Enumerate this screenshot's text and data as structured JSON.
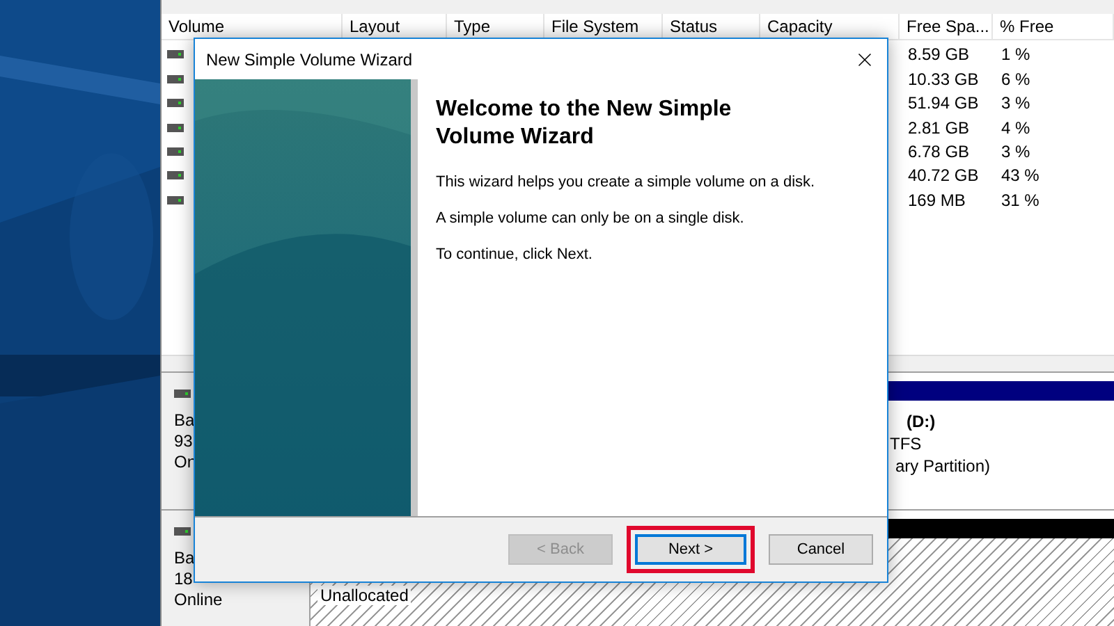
{
  "disk_management": {
    "columns": [
      "Volume",
      "Layout",
      "Type",
      "File System",
      "Status",
      "Capacity",
      "Free Spa...",
      "% Free"
    ],
    "rows": [
      {
        "free_space": "8.59 GB",
        "percent_free": "1 %"
      },
      {
        "free_space": "10.33 GB",
        "percent_free": "6 %"
      },
      {
        "free_space": "51.94 GB",
        "percent_free": "3 %"
      },
      {
        "free_space": "2.81 GB",
        "percent_free": "4 %"
      },
      {
        "free_space": "6.78 GB",
        "percent_free": "3 %"
      },
      {
        "free_space": "40.72 GB",
        "percent_free": "43 %"
      },
      {
        "free_space": "169 MB",
        "percent_free": "31 %"
      }
    ],
    "disks": [
      {
        "kind": "primary",
        "lines": [
          "Ba",
          "93",
          "On"
        ],
        "partition": {
          "name": "(D:)",
          "file_system": "TFS",
          "type": "ary Partition)"
        }
      },
      {
        "kind": "unallocated",
        "lines": [
          "Ba",
          "18",
          "Online"
        ],
        "partition": {
          "name": "Unallocated"
        }
      }
    ]
  },
  "wizard": {
    "title": "New Simple Volume Wizard",
    "heading": "Welcome to the New Simple Volume Wizard",
    "paragraphs": [
      "This wizard helps you create a simple volume on a disk.",
      "A simple volume can only be on a single disk.",
      "To continue, click Next."
    ],
    "buttons": [
      {
        "label": "< Back",
        "disabled": true,
        "default": false,
        "highlighted": false
      },
      {
        "label": "Next >",
        "disabled": false,
        "default": true,
        "highlighted": true
      },
      {
        "label": "Cancel",
        "disabled": false,
        "default": false,
        "highlighted": false
      }
    ]
  }
}
